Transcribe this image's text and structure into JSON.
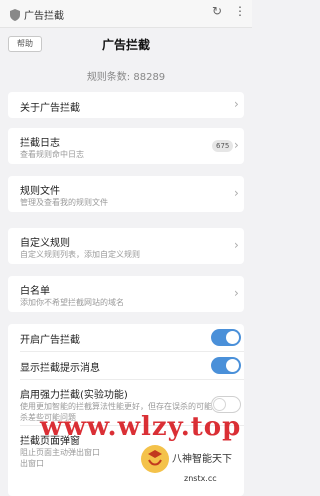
{
  "browser": {
    "url": "广告拦截",
    "reload_icon": "reload-icon",
    "more_icon": "more-vertical-icon"
  },
  "header": {
    "help_label": "帮助",
    "title": "广告拦截"
  },
  "rule_count": "规则条数: 88289",
  "menu": {
    "about": {
      "label": "关于广告拦截"
    },
    "log": {
      "label": "拦截日志",
      "sub": "查看规则命中日志",
      "badge": "675"
    },
    "rule_files": {
      "label": "规则文件",
      "sub": "管理及查看我的规则文件"
    },
    "custom_rules": {
      "label": "自定义规则",
      "sub": "自定义规则列表，添加自定义规则"
    },
    "whitelist": {
      "label": "白名单",
      "sub": "添加你不希望拦截网站的域名"
    }
  },
  "settings": {
    "enable": {
      "label": "开启广告拦截",
      "on": true
    },
    "show_msg": {
      "label": "显示拦截提示消息",
      "on": true
    },
    "strong": {
      "label": "启用强力拦截(实验功能)",
      "sub": "使用更加智能的拦截算法性能更好，但存在误杀的可能",
      "sub2": "杀差些可能问题",
      "on": false
    },
    "popup": {
      "label": "拦截页面弹窗",
      "sub": "阻止页面主动弹出窗口",
      "sub2": "出窗口"
    }
  },
  "watermark": {
    "site": "www.wlzy.top",
    "brand": "八神智能天下",
    "domain": "znstx.cc"
  },
  "colors": {
    "accent": "#4a90d9",
    "watermark": "#d71920"
  }
}
